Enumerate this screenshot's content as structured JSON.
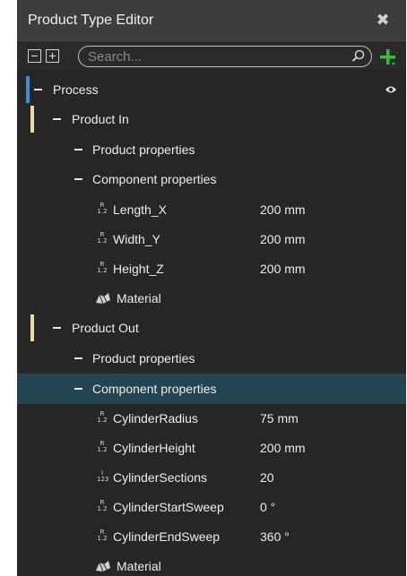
{
  "window": {
    "title": "Product Type Editor",
    "close_glyph": "✖"
  },
  "toolbar": {
    "collapse_glyph": "−",
    "expand_glyph": "+",
    "search_placeholder": "Search...",
    "search_icon": "search-icon",
    "add_icon": "plus-icon",
    "add_color": "#3dbb3d"
  },
  "tree": {
    "process": {
      "label": "Process",
      "marker_color": "#3f8fd6",
      "eye_icon": "eye-icon"
    },
    "product_in": {
      "label": "Product In",
      "marker_color": "#f2d7a1",
      "product_properties": "Product properties",
      "component_properties": "Component properties",
      "properties": [
        {
          "icon": "real-number-icon",
          "name": "Length_X",
          "value": "200 mm"
        },
        {
          "icon": "real-number-icon",
          "name": "Width_Y",
          "value": "200 mm"
        },
        {
          "icon": "real-number-icon",
          "name": "Height_Z",
          "value": "200 mm"
        }
      ],
      "material": "Material"
    },
    "product_out": {
      "label": "Product Out",
      "marker_color": "#f2d7a1",
      "product_properties": "Product properties",
      "component_properties": "Component properties",
      "selected_color": "#234451",
      "properties": [
        {
          "icon": "real-number-icon",
          "name": "CylinderRadius",
          "value": "75 mm"
        },
        {
          "icon": "real-number-icon",
          "name": "CylinderHeight",
          "value": "200 mm"
        },
        {
          "icon": "integer-icon",
          "name": "CylinderSections",
          "value": "20"
        },
        {
          "icon": "real-number-icon",
          "name": "CylinderStartSweep",
          "value": "0 °"
        },
        {
          "icon": "real-number-icon",
          "name": "CylinderEndSweep",
          "value": "360 °"
        }
      ],
      "material": "Material"
    }
  }
}
